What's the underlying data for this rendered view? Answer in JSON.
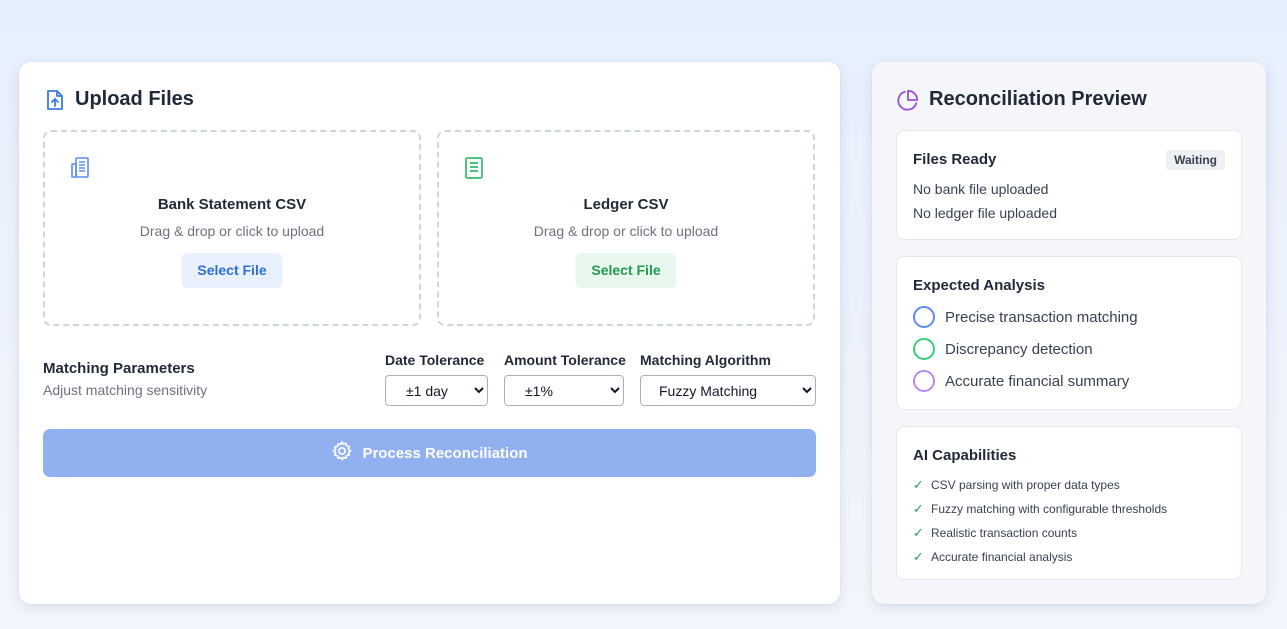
{
  "upload": {
    "title": "Upload Files",
    "bank": {
      "title": "Bank Statement CSV",
      "subtitle": "Drag & drop or click to upload",
      "button": "Select File",
      "icon": "bank-document-icon"
    },
    "ledger": {
      "title": "Ledger CSV",
      "subtitle": "Drag & drop or click to upload",
      "button": "Select File",
      "icon": "ledger-book-icon"
    },
    "params": {
      "title": "Matching Parameters",
      "subtitle": "Adjust matching sensitivity",
      "date_tolerance": {
        "label": "Date Tolerance",
        "value": "±1 day"
      },
      "amount_tolerance": {
        "label": "Amount Tolerance",
        "value": "±1%"
      },
      "algorithm": {
        "label": "Matching Algorithm",
        "value": "Fuzzy Matching"
      }
    },
    "process_button": "Process Reconciliation"
  },
  "preview": {
    "title": "Reconciliation Preview",
    "files_ready": {
      "title": "Files Ready",
      "badge": "Waiting",
      "bank_status": "No bank file uploaded",
      "ledger_status": "No ledger file uploaded"
    },
    "expected_analysis": {
      "title": "Expected Analysis",
      "items": [
        {
          "label": "Precise transaction matching",
          "color": "#5b8def"
        },
        {
          "label": "Discrepancy detection",
          "color": "#3ccf7a"
        },
        {
          "label": "Accurate financial summary",
          "color": "#b58cf0"
        }
      ]
    },
    "ai_capabilities": {
      "title": "AI Capabilities",
      "items": [
        "CSV parsing with proper data types",
        "Fuzzy matching with configurable thresholds",
        "Realistic transaction counts",
        "Accurate financial analysis"
      ]
    }
  },
  "colors": {
    "accent_blue": "#3b7be0",
    "accent_green": "#2fbf67",
    "accent_purple": "#9b4fd9",
    "process_button": "#90b0f0"
  }
}
